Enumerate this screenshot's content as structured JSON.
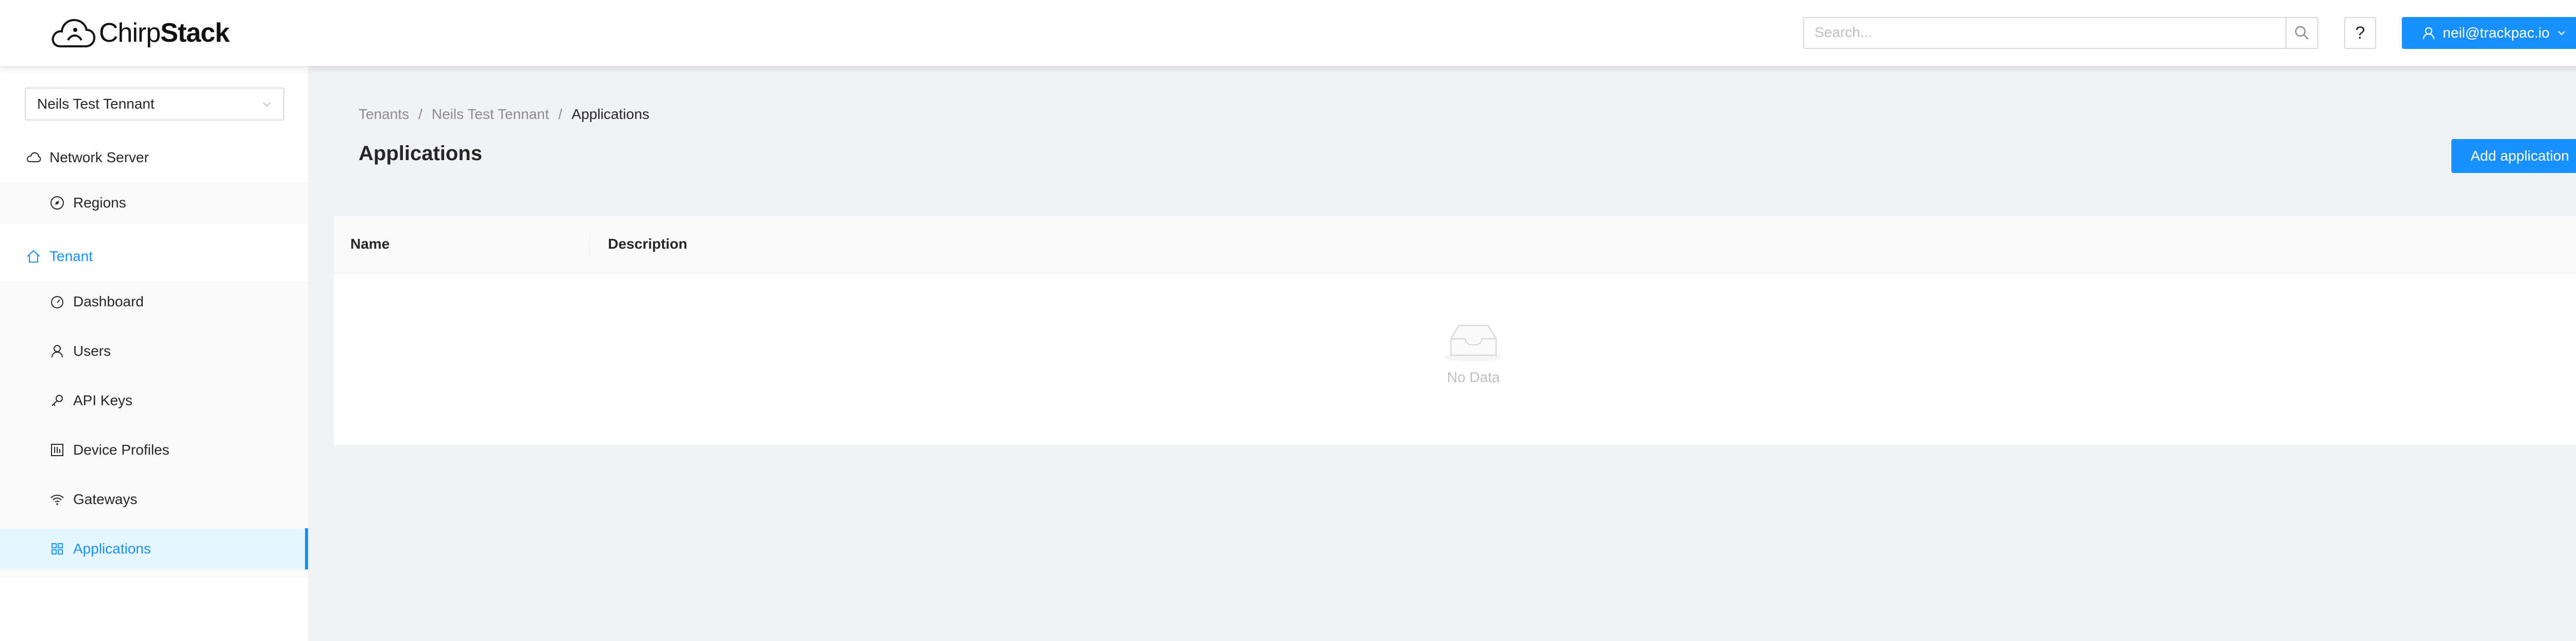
{
  "header": {
    "logo_text": "Chirp",
    "logo_text_bold_part": "Stack",
    "search_placeholder": "Search...",
    "help_label": "?",
    "user_email": "neil@trackpac.io",
    "accent_color": "#1890ff"
  },
  "sidebar": {
    "tenant_selected": "Neils Test Tennant",
    "network_server_label": "Network Server",
    "regions_label": "Regions",
    "tenant_label": "Tenant",
    "items": [
      {
        "label": "Dashboard",
        "icon": "dashboard-icon"
      },
      {
        "label": "Users",
        "icon": "user-icon"
      },
      {
        "label": "API Keys",
        "icon": "key-icon"
      },
      {
        "label": "Device Profiles",
        "icon": "device-profile-icon"
      },
      {
        "label": "Gateways",
        "icon": "wifi-icon"
      },
      {
        "label": "Applications",
        "icon": "appstore-icon"
      }
    ],
    "selected": "Applications"
  },
  "main": {
    "breadcrumb": [
      "Tenants",
      "Neils Test Tennant",
      "Applications"
    ],
    "breadcrumb_sep": "/",
    "title": "Applications",
    "add_button": "Add application",
    "table": {
      "columns": [
        "Name",
        "Description"
      ],
      "rows": [],
      "empty_text": "No Data"
    }
  }
}
